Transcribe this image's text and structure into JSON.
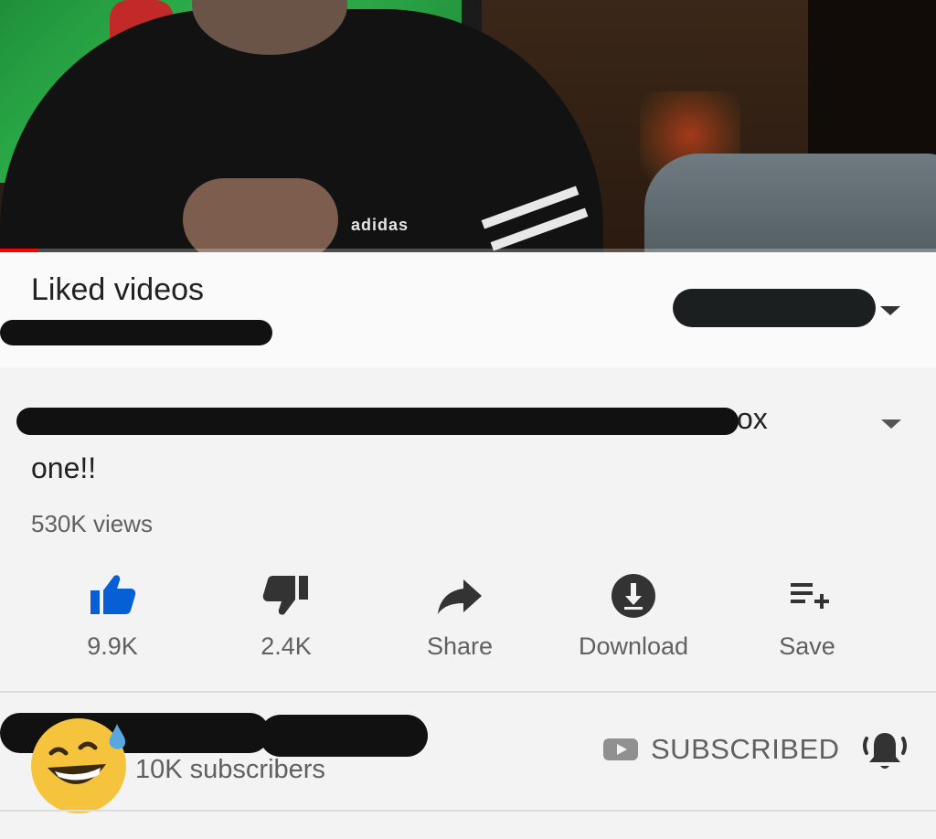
{
  "video": {
    "progress": 0.04,
    "colors": {
      "progress": "#ff0000"
    }
  },
  "playlist": {
    "title": "Liked videos"
  },
  "video_info": {
    "title_visible_tail": "ox",
    "title_line2": "one!!",
    "views": "530K views"
  },
  "actions": [
    {
      "label": "9.9K",
      "icon": "thumbs-up-icon",
      "active": true,
      "color": "#065fd4"
    },
    {
      "label": "2.4K",
      "icon": "thumbs-down-icon",
      "active": false,
      "color": "#333333"
    },
    {
      "label": "Share",
      "icon": "share-icon",
      "active": false,
      "color": "#333333"
    },
    {
      "label": "Download",
      "icon": "download-icon",
      "active": false,
      "color": "#333333"
    },
    {
      "label": "Save",
      "icon": "playlist-add-icon",
      "active": false,
      "color": "#333333"
    }
  ],
  "channel": {
    "subscribers": "10K subscribers",
    "subscribe_label": "SUBSCRIBED",
    "icons": [
      "youtube-icon",
      "bell-ringing-icon",
      "sweat-smile-emoji"
    ]
  }
}
